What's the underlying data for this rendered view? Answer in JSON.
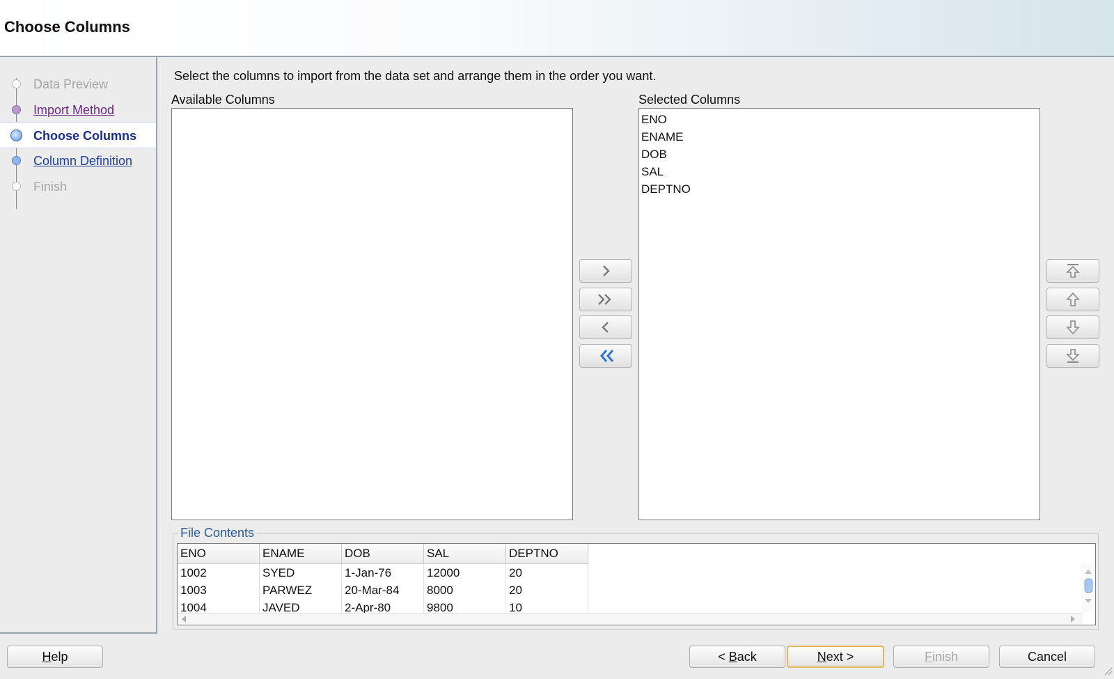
{
  "header": {
    "title": "Choose Columns"
  },
  "steps": [
    {
      "label": "Data Preview",
      "state": "disabled"
    },
    {
      "label": "Import Method",
      "state": "visited"
    },
    {
      "label": "Choose Columns",
      "state": "current"
    },
    {
      "label": "Column Definition",
      "state": "link"
    },
    {
      "label": "Finish",
      "state": "disabled"
    }
  ],
  "instruction": "Select the columns to import from the data set and arrange them in the order you want.",
  "available": {
    "label": "Available Columns",
    "items": []
  },
  "selected": {
    "label": "Selected Columns",
    "items": [
      "ENO",
      "ENAME",
      "DOB",
      "SAL",
      "DEPTNO"
    ]
  },
  "transfer_buttons": [
    "add-selected",
    "add-all",
    "remove-selected",
    "remove-all"
  ],
  "order_buttons": [
    "move-top",
    "move-up",
    "move-down",
    "move-bottom"
  ],
  "file_contents": {
    "label": "File Contents",
    "headers": [
      "ENO",
      "ENAME",
      "DOB",
      "SAL",
      "DEPTNO"
    ],
    "rows": [
      [
        "1002",
        "SYED",
        "1-Jan-76",
        "12000",
        "20"
      ],
      [
        "1003",
        "PARWEZ",
        "20-Mar-84",
        "8000",
        "20"
      ],
      [
        "1004",
        "JAVED",
        "2-Apr-80",
        "9800",
        "10"
      ]
    ]
  },
  "buttons": {
    "help": "Help",
    "back": "< Back",
    "next": "Next >",
    "finish": "Finish",
    "cancel": "Cancel"
  },
  "colors": {
    "link": "#1d3f9a",
    "visited": "#6b2a80",
    "current": "#1b2f86",
    "default_button_border": "#e8b457"
  }
}
